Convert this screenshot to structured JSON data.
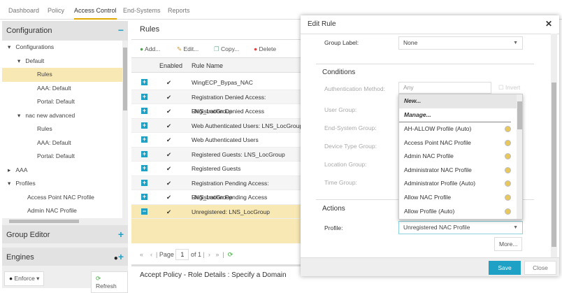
{
  "nav": {
    "tabs": [
      "Dashboard",
      "Policy",
      "Access Control",
      "End-Systems",
      "Reports"
    ],
    "active": "Access Control"
  },
  "left": {
    "configuration": "Configuration",
    "tree": [
      "Configurations",
      "Default",
      "Rules",
      "AAA: Default",
      "Portal: Default",
      "nac new advanced",
      "Rules",
      "AAA: Default",
      "Portal: Default",
      "AAA",
      "Profiles",
      "Access Point NAC Profile",
      "Admin NAC Profile"
    ],
    "group_editor": "Group Editor",
    "engines": "Engines",
    "enforce": "Enforce",
    "refresh": "Refresh"
  },
  "rules": {
    "title": "Rules",
    "toolbar": {
      "add": "Add...",
      "edit": "Edit...",
      "copy": "Copy...",
      "delete": "Delete"
    },
    "columns": [
      "Enabled",
      "Rule Name"
    ],
    "rows": [
      "WingECP_Bypas_NAC",
      "Registration Denied Access: LNS_LocGroup",
      "Registration Denied Access",
      "Web Authenticated Users: LNS_LocGroup",
      "Web Authenticated Users",
      "Registered Guests: LNS_LocGroup",
      "Registered Guests",
      "Registration Pending Access: LNS_LocGroup",
      "Registration Pending Access",
      "Unregistered: LNS_LocGroup"
    ],
    "check": "✔",
    "pager": {
      "page_label": "Page",
      "page": "1",
      "of": "of 1"
    },
    "bottom_title": "Accept Policy - Role Details : Specify a Domain"
  },
  "dialog": {
    "title": "Edit Rule",
    "group_label": "Group Label:",
    "group_value": "None",
    "conditions": "Conditions",
    "fields": [
      "Authentication Method:",
      "User Group:",
      "End-System Group:",
      "Device Type Group:",
      "Location Group:",
      "Time Group:"
    ],
    "auth_value": "Any",
    "invert": "Invert",
    "actions": "Actions",
    "profile_label": "Profile:",
    "profile_value": "Unregistered NAC Profile",
    "more": "More...",
    "save": "Save",
    "close": "Close",
    "dropdown": {
      "new": "New...",
      "manage": "Manage...",
      "items": [
        "AH-ALLOW Profile (Auto)",
        "Access Point NAC Profile",
        "Admin NAC Profile",
        "Administrator NAC Profile",
        "Administrator Profile (Auto)",
        "Allow NAC Profile",
        "Allow Profile (Auto)"
      ]
    }
  },
  "colors": {
    "accent": "#1ea1c4",
    "selected": "#f8e8b4",
    "tab_underline": "#e0a800"
  }
}
